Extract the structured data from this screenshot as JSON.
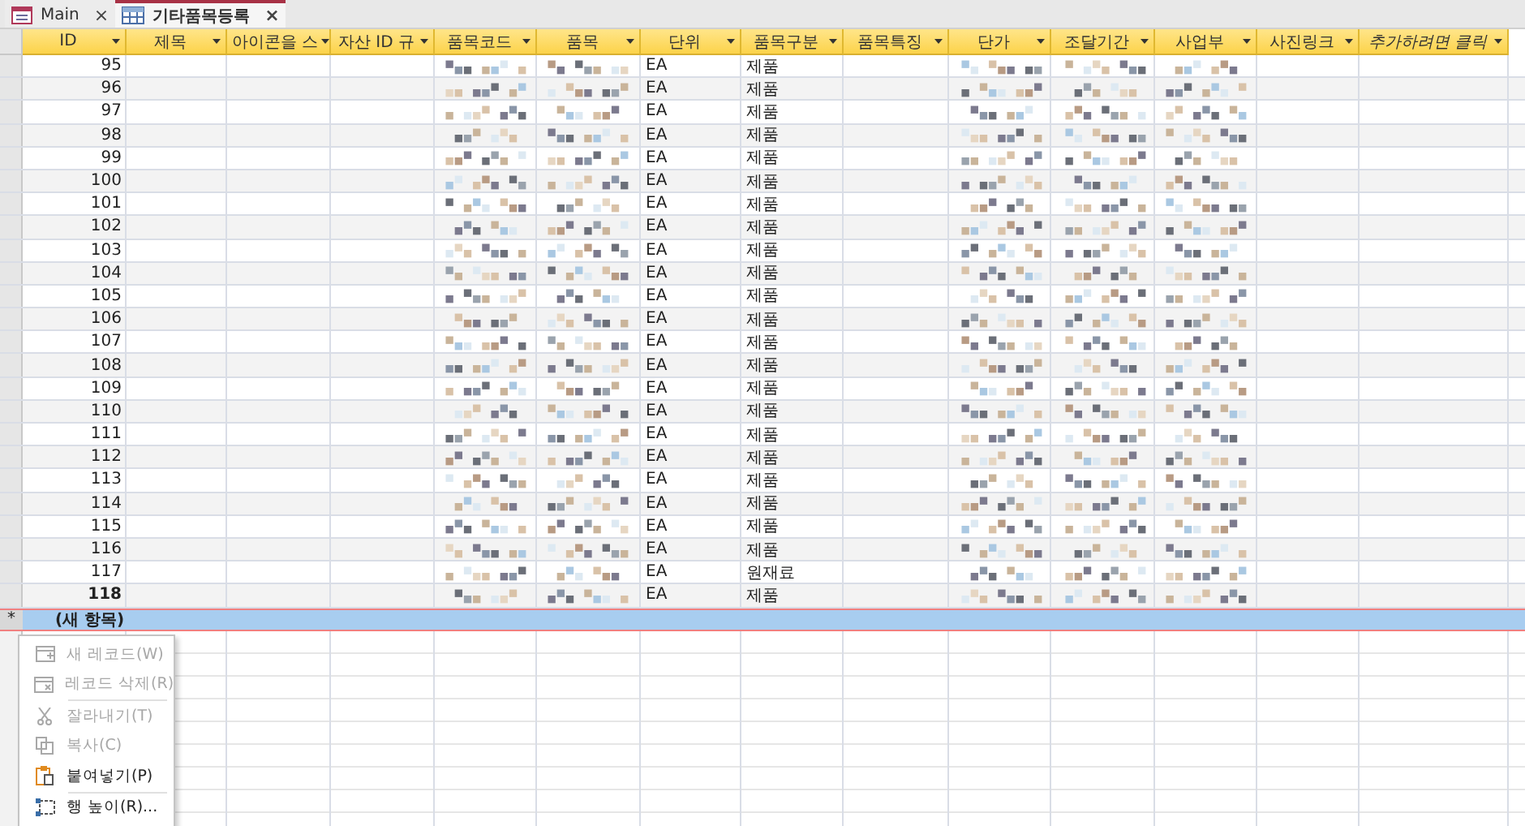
{
  "tabs": [
    {
      "label": "Main",
      "kind": "form",
      "close": "×",
      "selected": false
    },
    {
      "label": "기타품목등록",
      "kind": "table",
      "close": "×",
      "selected": true
    }
  ],
  "columns": [
    {
      "label": "ID",
      "italic": false,
      "kind": "number"
    },
    {
      "label": "제목",
      "italic": false,
      "kind": "text"
    },
    {
      "label": "아이콘을 스",
      "italic": false,
      "kind": "text"
    },
    {
      "label": "자산 ID 규",
      "italic": false,
      "kind": "text"
    },
    {
      "label": "품목코드",
      "italic": false,
      "kind": "masked"
    },
    {
      "label": "품목",
      "italic": false,
      "kind": "masked"
    },
    {
      "label": "단위",
      "italic": false,
      "kind": "text"
    },
    {
      "label": "품목구분",
      "italic": false,
      "kind": "text"
    },
    {
      "label": "품목특징",
      "italic": false,
      "kind": "text"
    },
    {
      "label": "단가",
      "italic": false,
      "kind": "masked-number"
    },
    {
      "label": "조달기간",
      "italic": false,
      "kind": "masked-number"
    },
    {
      "label": "사업부",
      "italic": false,
      "kind": "masked"
    },
    {
      "label": "사진링크",
      "italic": false,
      "kind": "text"
    },
    {
      "label": "추가하려면 클릭",
      "italic": true,
      "kind": "text"
    }
  ],
  "rows": [
    {
      "id": "95",
      "unit": "EA",
      "category": "제품",
      "current": false
    },
    {
      "id": "96",
      "unit": "EA",
      "category": "제품",
      "current": false
    },
    {
      "id": "97",
      "unit": "EA",
      "category": "제품",
      "current": false
    },
    {
      "id": "98",
      "unit": "EA",
      "category": "제품",
      "current": false
    },
    {
      "id": "99",
      "unit": "EA",
      "category": "제품",
      "current": false
    },
    {
      "id": "100",
      "unit": "EA",
      "category": "제품",
      "current": false
    },
    {
      "id": "101",
      "unit": "EA",
      "category": "제품",
      "current": false
    },
    {
      "id": "102",
      "unit": "EA",
      "category": "제품",
      "current": false
    },
    {
      "id": "103",
      "unit": "EA",
      "category": "제품",
      "current": false
    },
    {
      "id": "104",
      "unit": "EA",
      "category": "제품",
      "current": false
    },
    {
      "id": "105",
      "unit": "EA",
      "category": "제품",
      "current": false
    },
    {
      "id": "106",
      "unit": "EA",
      "category": "제품",
      "current": false
    },
    {
      "id": "107",
      "unit": "EA",
      "category": "제품",
      "current": false
    },
    {
      "id": "108",
      "unit": "EA",
      "category": "제품",
      "current": false
    },
    {
      "id": "109",
      "unit": "EA",
      "category": "제품",
      "current": false
    },
    {
      "id": "110",
      "unit": "EA",
      "category": "제품",
      "current": false
    },
    {
      "id": "111",
      "unit": "EA",
      "category": "제품",
      "current": false
    },
    {
      "id": "112",
      "unit": "EA",
      "category": "제품",
      "current": false
    },
    {
      "id": "113",
      "unit": "EA",
      "category": "제품",
      "current": false
    },
    {
      "id": "114",
      "unit": "EA",
      "category": "제품",
      "current": false
    },
    {
      "id": "115",
      "unit": "EA",
      "category": "제품",
      "current": false
    },
    {
      "id": "116",
      "unit": "EA",
      "category": "제품",
      "current": false
    },
    {
      "id": "117",
      "unit": "EA",
      "category": "원재료",
      "current": false
    },
    {
      "id": "118",
      "unit": "EA",
      "category": "제품",
      "current": true
    }
  ],
  "new_row": {
    "marker": "*",
    "label": "(새 항목)",
    "selected": true
  },
  "context_menu": [
    {
      "label": "새 레코드(W)",
      "kind": "new-record",
      "disabled": true,
      "separator_after": false
    },
    {
      "label": "레코드 삭제(R)",
      "kind": "delete-record",
      "disabled": true,
      "separator_after": true
    },
    {
      "label": "잘라내기(T)",
      "kind": "cut",
      "disabled": true,
      "separator_after": false
    },
    {
      "label": "복사(C)",
      "kind": "copy",
      "disabled": true,
      "separator_after": false
    },
    {
      "label": "붙여넣기(P)",
      "kind": "paste",
      "disabled": false,
      "separator_after": true
    },
    {
      "label": "행 높이(R)...",
      "kind": "row-height",
      "disabled": false,
      "separator_after": false
    }
  ]
}
